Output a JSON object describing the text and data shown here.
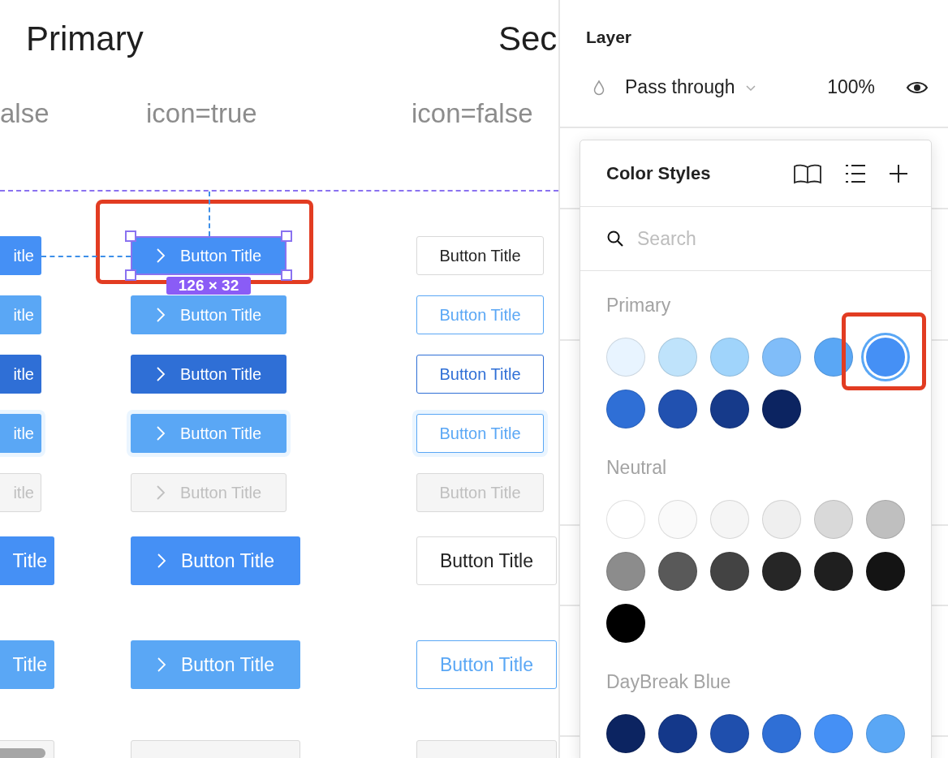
{
  "canvas": {
    "title": "Primary",
    "title_2": "Sec",
    "column_headers": [
      "alse",
      "icon=true",
      "icon=false"
    ],
    "rows": [
      {
        "kind": "default",
        "large": false,
        "cells": [
          {
            "text": "itle",
            "selected": false
          },
          {
            "text": "Button Title",
            "selected": true
          },
          {
            "text": "Button Title",
            "selected": false
          }
        ]
      },
      {
        "kind": "hover",
        "large": false,
        "cells": [
          {
            "text": "itle",
            "selected": false
          },
          {
            "text": "Button Title",
            "selected": false
          },
          {
            "text": "Button Title",
            "selected": false
          }
        ]
      },
      {
        "kind": "pressed",
        "large": false,
        "cells": [
          {
            "text": "itle",
            "selected": false
          },
          {
            "text": "Button Title",
            "selected": false
          },
          {
            "text": "Button Title",
            "selected": false
          }
        ]
      },
      {
        "kind": "focused",
        "large": false,
        "cells": [
          {
            "text": "itle",
            "selected": false
          },
          {
            "text": "Button Title",
            "selected": false
          },
          {
            "text": "Button Title",
            "selected": false
          }
        ]
      },
      {
        "kind": "disabled",
        "large": false,
        "cells": [
          {
            "text": "itle",
            "selected": false
          },
          {
            "text": "Button Title",
            "selected": false
          },
          {
            "text": "Button Title",
            "selected": false
          }
        ]
      },
      {
        "kind": "default",
        "large": true,
        "cells": [
          {
            "text": "Title",
            "selected": false
          },
          {
            "text": "Button Title",
            "selected": false
          },
          {
            "text": "Button Title",
            "selected": false
          }
        ]
      },
      {
        "kind": "hover",
        "large": true,
        "cells": [
          {
            "text": "Title",
            "selected": false
          },
          {
            "text": "Button Title",
            "selected": false
          },
          {
            "text": "Button Title",
            "selected": false
          }
        ]
      },
      {
        "kind": "disabled",
        "large": true,
        "cells": [
          {
            "selected": false
          },
          {
            "selected": false
          },
          {
            "selected": false
          }
        ]
      }
    ],
    "size_label": "126 × 32"
  },
  "layer": {
    "title": "Layer",
    "blend_mode": "Pass through",
    "opacity": "100%"
  },
  "color_styles": {
    "title": "Color Styles",
    "search": {
      "placeholder": "Search"
    },
    "groups": [
      {
        "name": "Primary",
        "swatches": [
          {
            "color": "#e8f4ff",
            "selected": false
          },
          {
            "color": "#bfe3fb",
            "selected": false
          },
          {
            "color": "#a0d4fb",
            "selected": false
          },
          {
            "color": "#80bdf9",
            "selected": false
          },
          {
            "color": "#5aa7f5",
            "selected": false
          },
          {
            "color": "#4590f5",
            "selected": true
          },
          {
            "color": "#2f6fd6",
            "selected": false
          },
          {
            "color": "#2151b0",
            "selected": false
          },
          {
            "color": "#163a8a",
            "selected": false
          },
          {
            "color": "#0c2461",
            "selected": false
          }
        ]
      },
      {
        "name": "Neutral",
        "swatches": [
          {
            "color": "#ffffff",
            "selected": false
          },
          {
            "color": "#fafafa",
            "selected": false
          },
          {
            "color": "#f5f5f5",
            "selected": false
          },
          {
            "color": "#efefef",
            "selected": false
          },
          {
            "color": "#d9d9d9",
            "selected": false
          },
          {
            "color": "#bfbfbf",
            "selected": false
          },
          {
            "color": "#8c8c8c",
            "selected": false
          },
          {
            "color": "#595959",
            "selected": false
          },
          {
            "color": "#434343",
            "selected": false
          },
          {
            "color": "#262626",
            "selected": false
          },
          {
            "color": "#1f1f1f",
            "selected": false
          },
          {
            "color": "#141414",
            "selected": false
          },
          {
            "color": "#000000",
            "selected": false
          }
        ]
      },
      {
        "name": "DayBreak Blue",
        "swatches": [
          {
            "color": "#0c2461",
            "selected": false
          },
          {
            "color": "#14388a",
            "selected": false
          },
          {
            "color": "#1f4fad",
            "selected": false
          },
          {
            "color": "#2f6fd6",
            "selected": false
          },
          {
            "color": "#4590f5",
            "selected": false
          },
          {
            "color": "#5aa7f5",
            "selected": false
          }
        ]
      }
    ]
  }
}
